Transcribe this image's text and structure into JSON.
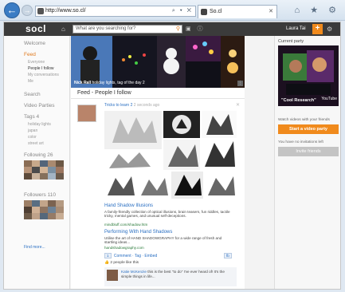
{
  "browser": {
    "address": "http://www.so.cl/",
    "address_tools": "⌕ ▾ ✕",
    "tab_title": "So.cl",
    "tab_close": "✕",
    "right_tools": "⌂ ★ ⚙"
  },
  "topbar": {
    "logo": "socl",
    "search_placeholder": "What are you searching for?",
    "user_name": "Laura Tai",
    "plus_label": "+"
  },
  "left_nav": {
    "welcome": "Welcome",
    "feed": "Feed",
    "feed_items": [
      "Everyone",
      "People I follow",
      "My conversations",
      "Me"
    ],
    "search": "Search",
    "video_parties": "Video Parties",
    "tags_header": "Tags 4",
    "tags": [
      "holiday lights",
      "japan",
      "color",
      "street art"
    ],
    "following_header": "Following 26",
    "followers_header": "Followers 110",
    "find_more": "Find more..."
  },
  "banner": {
    "name": "Nick Rall",
    "caption": "holiday lights, tag of the day 2"
  },
  "feed": {
    "title": "Feed - People I follow",
    "post_author": "Tricks to learn 2",
    "post_time": "2 seconds ago",
    "link1_title": "Hand Shadow Illusions",
    "link1_desc": "A family-friendly collection of optical illusions, brain teasers, fun riddles, tactile tricky, mental games, and unusual self-deceptions.",
    "link1_source": "mindbluff.com/shadow.htm",
    "link2_title": "Performing With Hand Shadows",
    "link2_desc": "Utilise the art of HAND SHADOWGRAPHY for a wide range of fresh and startling ideas...",
    "link2_source": "handshadowgraphy.com",
    "comment_count": "1",
    "actions": "Comment · Tag · Embed",
    "follow_btn": "fb",
    "likes_text": "2 people like this",
    "comment_author": "Katie McKenzie",
    "comment_text": "this is the best \"to do\" I've ever heard of! It's the simple things in life..."
  },
  "right": {
    "current_party": "Current party",
    "party_caption": "\"Cool Research\"",
    "party_brand": "YouTube",
    "watch_text": "Watch videos with your friends",
    "start_btn": "Start a video party",
    "no_invitations": "You have no invitations left",
    "invite_btn": "Invite friends"
  },
  "colors": {
    "accent": "#f08a1c",
    "link": "#2a6fc2",
    "topbar": "#3b3b3b"
  }
}
